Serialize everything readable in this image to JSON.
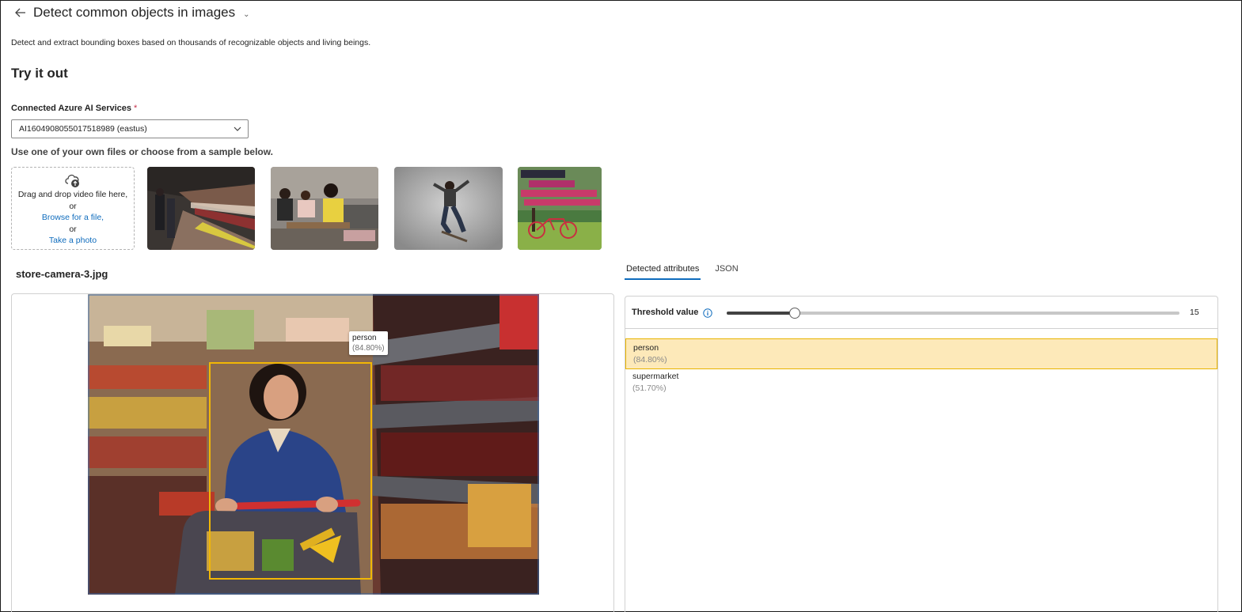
{
  "header": {
    "title": "Detect common objects in images",
    "subtitle": "Detect and extract bounding boxes based on thousands of recognizable objects and living beings."
  },
  "try_it_out": {
    "heading": "Try it out",
    "service_label": "Connected Azure AI Services",
    "required_marker": "*",
    "service_value": "AI1604908055017518989 (eastus)",
    "hint": "Use one of your own files or choose from a sample below."
  },
  "upload": {
    "drag_text": "Drag and drop video file here,",
    "or_1": "or",
    "browse_link": "Browse for a file,",
    "or_2": "or",
    "photo_link": "Take a photo"
  },
  "samples": [
    {
      "icon": "subway-platform-image"
    },
    {
      "icon": "people-meeting-image"
    },
    {
      "icon": "skateboarder-image"
    },
    {
      "icon": "bicycle-poster-image"
    }
  ],
  "preview": {
    "file_name": "store-camera-3.jpg",
    "detection_label": "person",
    "detection_pct": "(84.80%)"
  },
  "results": {
    "tabs": [
      {
        "label": "Detected attributes",
        "active": true
      },
      {
        "label": "JSON",
        "active": false
      }
    ],
    "threshold_label": "Threshold value",
    "threshold_value": "15",
    "threshold_fraction": 0.15,
    "attributes": [
      {
        "name": "person",
        "pct": "(84.80%)",
        "selected": true
      },
      {
        "name": "supermarket",
        "pct": "(51.70%)",
        "selected": false
      }
    ]
  },
  "colors": {
    "accent": "#0f6cbd",
    "highlight": "#fde9b9",
    "bbox": "#f2b705"
  }
}
